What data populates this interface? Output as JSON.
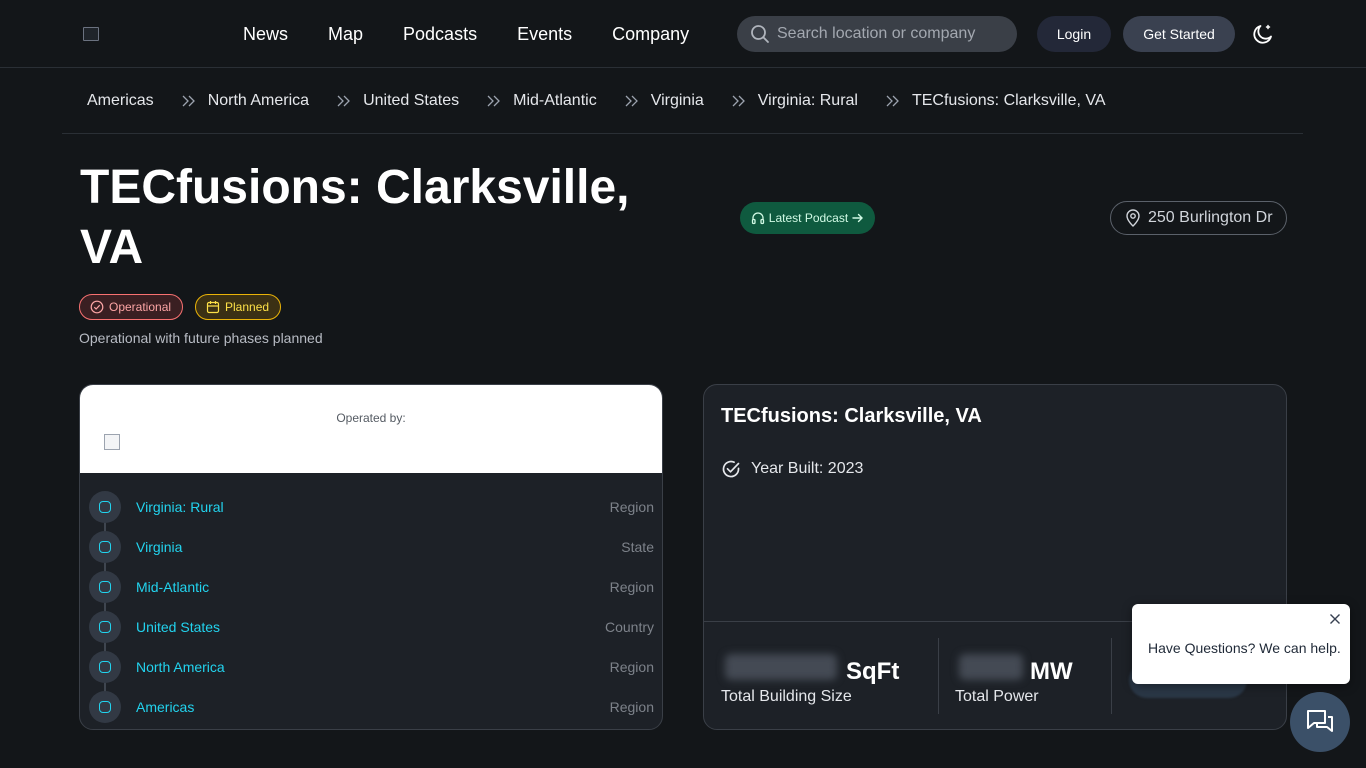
{
  "header": {
    "nav": [
      "News",
      "Map",
      "Podcasts",
      "Events",
      "Company"
    ],
    "search_placeholder": "Search location or company",
    "login_label": "Login",
    "get_started_label": "Get Started",
    "theme_icon": "moon-icon"
  },
  "breadcrumb": [
    "Americas",
    "North America",
    "United States",
    "Mid-Atlantic",
    "Virginia",
    "Virginia: Rural",
    "TECfusions: Clarksville, VA"
  ],
  "page": {
    "title": "TECfusions: Clarksville, VA",
    "podcast_label": "Latest Podcast",
    "address": "250 Burlington Dr",
    "badges": {
      "operational": "Operational",
      "planned": "Planned"
    },
    "status_description": "Operational with future phases planned"
  },
  "operator": {
    "label": "Operated by:"
  },
  "hierarchy": [
    {
      "name": "Virginia: Rural",
      "type": "Region"
    },
    {
      "name": "Virginia",
      "type": "State"
    },
    {
      "name": "Mid-Atlantic",
      "type": "Region"
    },
    {
      "name": "United States",
      "type": "Country"
    },
    {
      "name": "North America",
      "type": "Region"
    },
    {
      "name": "Americas",
      "type": "Region"
    }
  ],
  "facility": {
    "title": "TECfusions: Clarksville, VA",
    "year_built": "Year Built: 2023",
    "stats": {
      "size_unit": "SqFt",
      "size_label": "Total Building Size",
      "power_unit": "MW",
      "power_label": "Total Power"
    }
  },
  "chat": {
    "message": "Have Questions? We can help."
  },
  "colors": {
    "background": "#131619",
    "accent_cyan": "#22d3ee",
    "operational_red": "#f87171",
    "planned_yellow": "#eab308",
    "podcast_green": "#0f5a3f"
  }
}
